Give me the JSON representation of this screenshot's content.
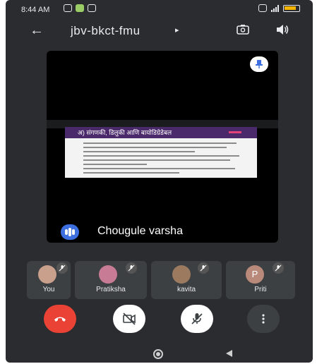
{
  "status_bar": {
    "time": "8:44 AM"
  },
  "top_bar": {
    "meeting_code": "jbv-bkct-fmu",
    "caret": "▸",
    "back_symbol": "←"
  },
  "presentation": {
    "slide_title": "अ) संगणकी, डिलुकी आणि बायोडिग्रेडेबल",
    "speaker_name": "Chougule varsha"
  },
  "participants": [
    {
      "name": "You",
      "muted": true
    },
    {
      "name": "Pratiksha",
      "muted": true
    },
    {
      "name": "kavita",
      "muted": true
    },
    {
      "name": "Priti",
      "initial": "P",
      "muted": true
    }
  ],
  "controls": {
    "end_call": "end-call-icon",
    "camera": "camera-off-icon",
    "mic": "mic-off-icon",
    "more": "more-vert-icon"
  },
  "colors": {
    "end_call": "#ea4335",
    "active_speaker": "#3d6fe0",
    "background": "#2b2c2f"
  }
}
